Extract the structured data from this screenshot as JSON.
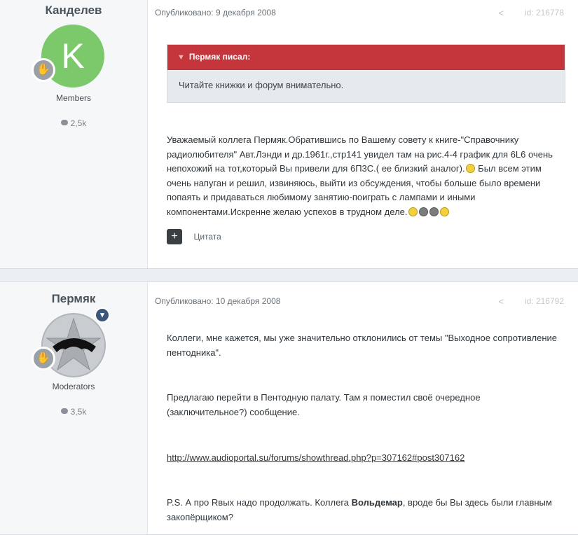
{
  "posts": [
    {
      "author": "Канделев",
      "avatar_letter": "K",
      "group": "Members",
      "count": "2,5k",
      "date": "Опубликовано: 9 декабря 2008",
      "id": "id: 216778",
      "quote": {
        "author": "Пермяк писал:",
        "text": "Читайте книжки и форум внимательно."
      },
      "body": {
        "part1": "Уважаемый коллега Пермяк.Обратившись по Вашему совету к книге-\"Справочнику радиолюбителя\" Авт.Лэнди и др.1961г.,стр141 увидел там на рис.4-4 график для 6L6 очень непохожий на тот,который Вы привели для 6П3С.( ее близкий аналог).",
        "part2": " Был всем этим очень напуган и решил, извиняюсь, выйти из обсуждения, чтобы больше было времени попаять и придаваться любимому занятию-поиграть с лампами и иными компонентами.Искренне желаю успехов в трудном деле."
      },
      "quote_button": "Цитата"
    },
    {
      "author": "Пермяк",
      "group": "Moderators",
      "count": "3,5k",
      "date": "Опубликовано: 10 декабря 2008",
      "id": "id: 216792",
      "paragraphs": [
        "Коллеги, мне кажется, мы уже значительно отклонились от темы \"Выходное сопротивление пентодника\".",
        "Предлагаю перейти в Пентодную палату. Там я поместил своё очередное (заключительное?) сообщение."
      ],
      "link": "http://www.audioportal.su/forums/showthread.php?p=307162#post307162",
      "ps_before": "P.S. А про Rвых надо продолжать. Коллега ",
      "ps_bold": "Вольдемар",
      "ps_after": ", вроде бы Вы здесь были главным закопёрщиком?"
    }
  ]
}
